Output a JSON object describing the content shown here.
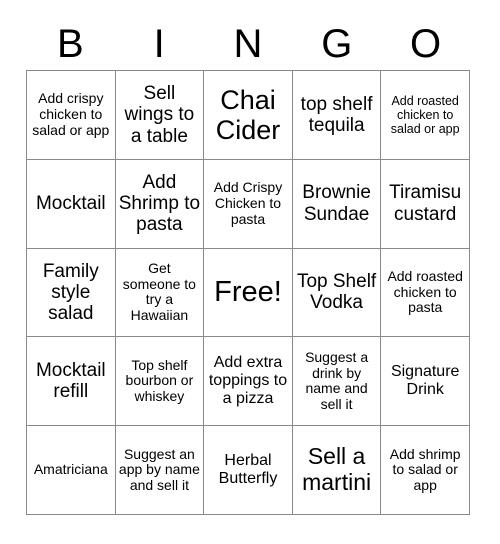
{
  "card": {
    "title_letters": [
      "B",
      "I",
      "N",
      "G",
      "O"
    ],
    "columns": 5,
    "rows": 5,
    "border_color": "#8a8a8a",
    "text_color": "#000000",
    "background_color": "#ffffff",
    "cells": [
      [
        {
          "text": "Add crispy chicken to salad or app",
          "size": "s-sm"
        },
        {
          "text": "Sell wings to a table",
          "size": "s-lg"
        },
        {
          "text": "Chai Cider",
          "size": "s-xxl"
        },
        {
          "text": "top shelf tequila",
          "size": "s-lg"
        },
        {
          "text": "Add roasted chicken to salad or app",
          "size": "s-xs"
        }
      ],
      [
        {
          "text": "Mocktail",
          "size": "s-lg"
        },
        {
          "text": "Add Shrimp to pasta",
          "size": "s-lg"
        },
        {
          "text": "Add Crispy Chicken to pasta",
          "size": "s-sm"
        },
        {
          "text": "Brownie Sundae",
          "size": "s-lg"
        },
        {
          "text": "Tiramisu custard",
          "size": "s-lg"
        }
      ],
      [
        {
          "text": "Family style salad",
          "size": "s-lg"
        },
        {
          "text": "Get someone to try a Hawaiian",
          "size": "s-sm"
        },
        {
          "text": "Free!",
          "size": "s-free"
        },
        {
          "text": "Top Shelf Vodka",
          "size": "s-lg"
        },
        {
          "text": "Add roasted chicken to pasta",
          "size": "s-sm"
        }
      ],
      [
        {
          "text": "Mocktail refill",
          "size": "s-lg"
        },
        {
          "text": "Top shelf bourbon or whiskey",
          "size": "s-sm"
        },
        {
          "text": "Add extra toppings to a pizza",
          "size": "s-md"
        },
        {
          "text": "Suggest a drink by name and sell it",
          "size": "s-sm"
        },
        {
          "text": "Signature Drink",
          "size": "s-md"
        }
      ],
      [
        {
          "text": "Amatriciana",
          "size": "s-sm"
        },
        {
          "text": "Suggest an app by name and sell it",
          "size": "s-sm"
        },
        {
          "text": "Herbal Butterfly",
          "size": "s-md"
        },
        {
          "text": "Sell a martini",
          "size": "s-xl"
        },
        {
          "text": "Add shrimp to salad or app",
          "size": "s-sm"
        }
      ]
    ]
  }
}
